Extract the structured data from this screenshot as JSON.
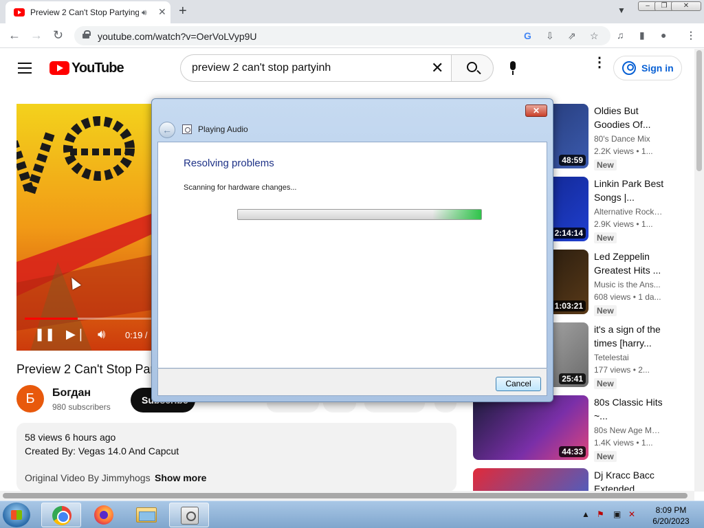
{
  "browser": {
    "tab_title": "Preview 2 Can't Stop Partying",
    "tab_audio_icon": "speaker-icon",
    "url": "youtube.com/watch?v=OerVoLVyp9U"
  },
  "youtube": {
    "logo_text": "YouTube",
    "search_query": "preview 2 can't stop partyinh",
    "signin_label": "Sign in"
  },
  "video": {
    "time": "0:19 /",
    "title": "Preview 2 Can't Stop Partying",
    "progress_fraction": 0.42,
    "channel_initial": "Б",
    "channel_name": "Богдан",
    "subscribers": "980 subscribers",
    "subscribe_label": "Subscribe",
    "views_age": "58 views  6 hours ago",
    "created_by": "Created By: Vegas 14.0 And Capcut",
    "original": "Original Video By Jimmyhogs",
    "show_more": "Show more"
  },
  "recommendations": [
    {
      "title": "Oldies But Goodies Of...",
      "channel": "80's Dance Mix",
      "meta": "2.2K views • 1...",
      "badge": "New",
      "duration": "48:59"
    },
    {
      "title": "Linkin Park Best Songs |...",
      "channel": "Alternative Rock ...",
      "meta": "2.9K views • 1...",
      "badge": "New",
      "duration": "2:14:14"
    },
    {
      "title": "Led Zeppelin Greatest Hits ...",
      "channel": "Music is the Ans...",
      "meta": "608 views • 1 da...",
      "badge": "New",
      "duration": "1:03:21"
    },
    {
      "title": "it's a sign of the times [harry...",
      "channel": "Tetelestai",
      "meta": "177 views • 2...",
      "badge": "New",
      "duration": "25:41"
    },
    {
      "title": "80s Classic Hits ~...",
      "channel": "80s New Age Mu...",
      "meta": "1.4K views • 1...",
      "badge": "New",
      "duration": "44:33"
    },
    {
      "title": "Dj Kracc Bacc Extended",
      "channel": "",
      "meta": "",
      "badge": "",
      "duration": ""
    }
  ],
  "dialog": {
    "window_title": "Playing Audio",
    "heading": "Resolving problems",
    "status": "Scanning for hardware changes...",
    "cancel_label": "Cancel",
    "close_label": "✕"
  },
  "taskbar": {
    "time": "8:09 PM",
    "date": "6/20/2023"
  },
  "colors": {
    "youtube_red": "#ff0000",
    "link_blue": "#065fd4",
    "dialog_heading": "#1e3287"
  }
}
